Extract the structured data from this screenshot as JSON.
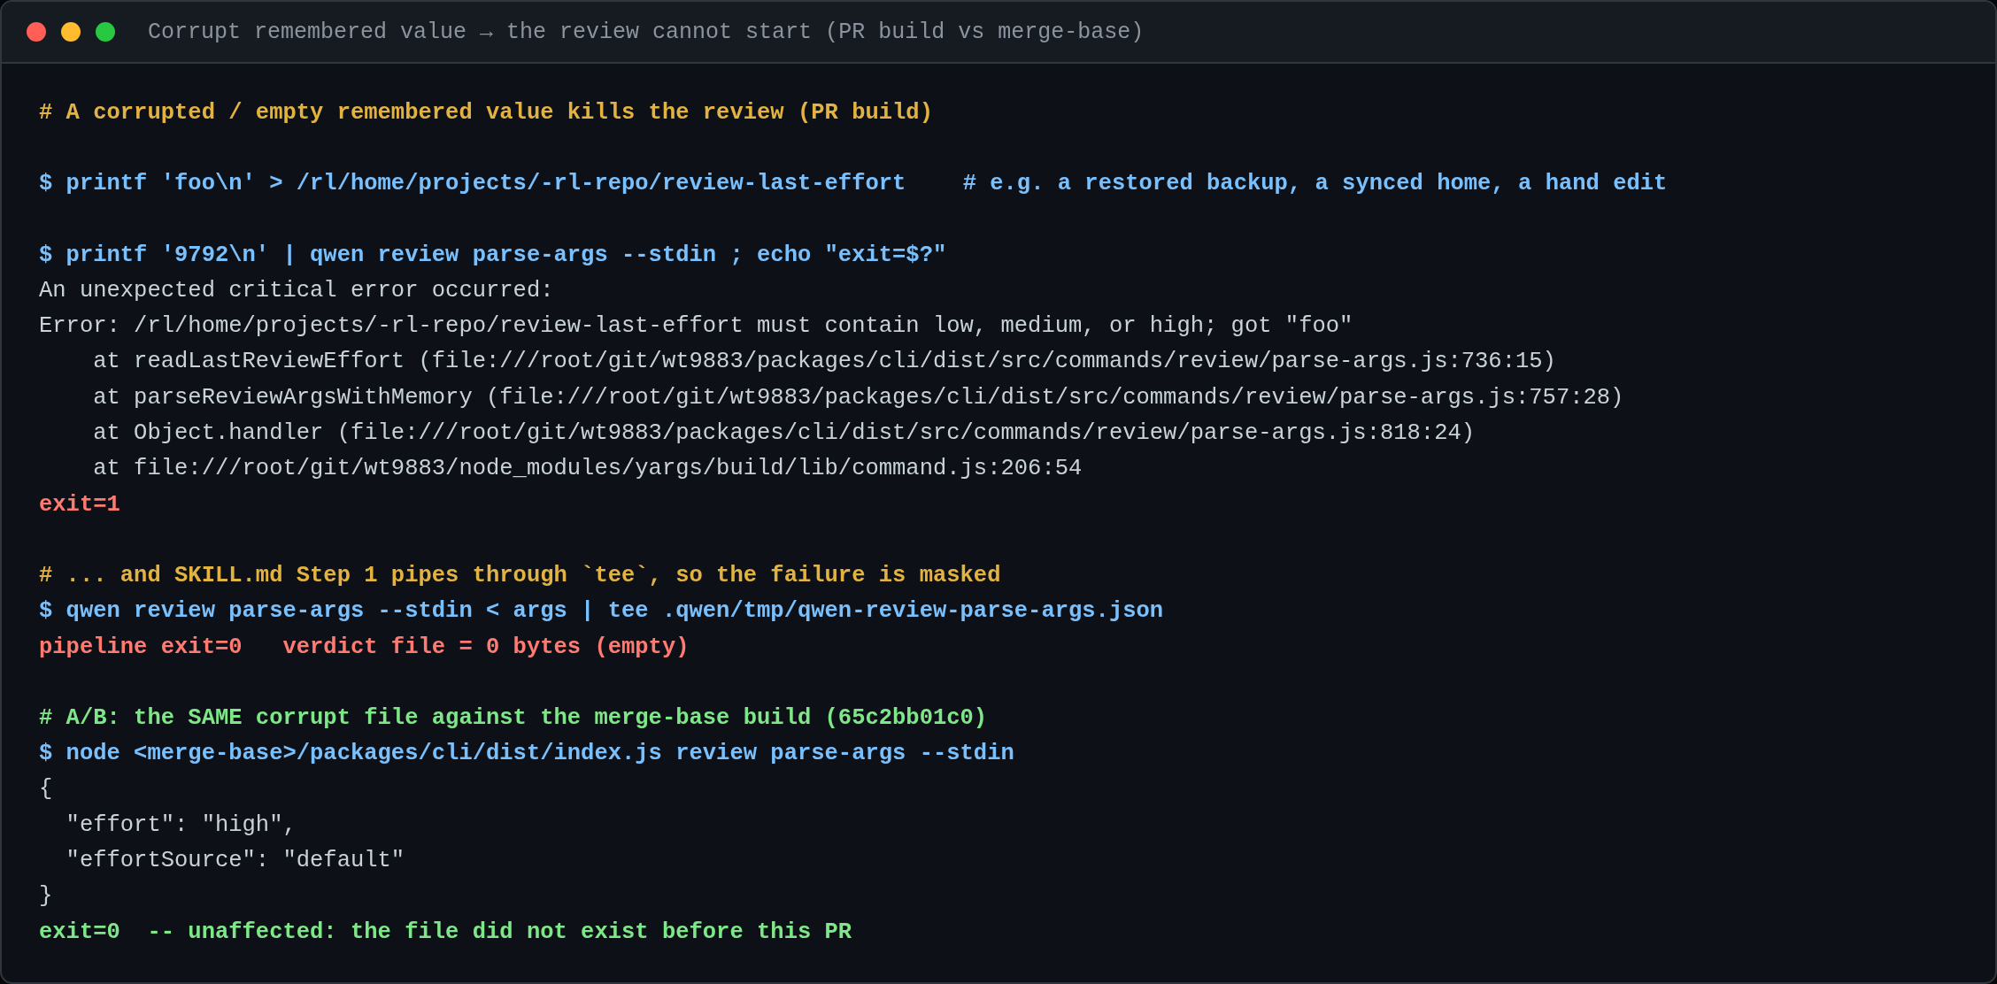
{
  "window": {
    "title": "Corrupt remembered value → the review cannot start (PR build vs merge-base)"
  },
  "blocks": [
    {
      "lines": [
        {
          "kind": "comment",
          "text": "# A corrupted / empty remembered value kills the review (PR build)"
        }
      ]
    },
    {
      "lines": [
        {
          "kind": "command",
          "text": "$ printf 'foo\\n' > /rl/home/projects/-rl-repo/review-last-effort",
          "note": "# e.g. a restored backup, a synced home, a hand edit"
        }
      ]
    },
    {
      "lines": [
        {
          "kind": "command",
          "text": "$ printf '9792\\n' | qwen review parse-args --stdin ; echo \"exit=$?\""
        },
        {
          "kind": "output",
          "text": "An unexpected critical error occurred:"
        },
        {
          "kind": "output",
          "text": "Error: /rl/home/projects/-rl-repo/review-last-effort must contain low, medium, or high; got \"foo\""
        },
        {
          "kind": "output",
          "text": "    at readLastReviewEffort (file:///root/git/wt9883/packages/cli/dist/src/commands/review/parse-args.js:736:15)"
        },
        {
          "kind": "output",
          "text": "    at parseReviewArgsWithMemory (file:///root/git/wt9883/packages/cli/dist/src/commands/review/parse-args.js:757:28)"
        },
        {
          "kind": "output",
          "text": "    at Object.handler (file:///root/git/wt9883/packages/cli/dist/src/commands/review/parse-args.js:818:24)"
        },
        {
          "kind": "output",
          "text": "    at file:///root/git/wt9883/node_modules/yargs/build/lib/command.js:206:54"
        },
        {
          "kind": "error",
          "text": "exit=1"
        }
      ]
    },
    {
      "lines": [
        {
          "kind": "comment",
          "text": "# ... and SKILL.md Step 1 pipes through `tee`, so the failure is masked"
        },
        {
          "kind": "command",
          "text": "$ qwen review parse-args --stdin < args | tee .qwen/tmp/qwen-review-parse-args.json"
        },
        {
          "kind": "error",
          "text": "pipeline exit=0   verdict file = 0 bytes (empty)"
        }
      ]
    },
    {
      "lines": [
        {
          "kind": "pass",
          "text": "# A/B: the SAME corrupt file against the merge-base build (65c2bb01c0)"
        },
        {
          "kind": "command",
          "text": "$ node <merge-base>/packages/cli/dist/index.js review parse-args --stdin"
        },
        {
          "kind": "output",
          "text": "{"
        },
        {
          "kind": "output",
          "text": "  \"effort\": \"high\","
        },
        {
          "kind": "output",
          "text": "  \"effortSource\": \"default\""
        },
        {
          "kind": "output",
          "text": "}"
        },
        {
          "kind": "pass",
          "text": "exit=0  -- unaffected: the file did not exist before this PR"
        }
      ]
    }
  ]
}
